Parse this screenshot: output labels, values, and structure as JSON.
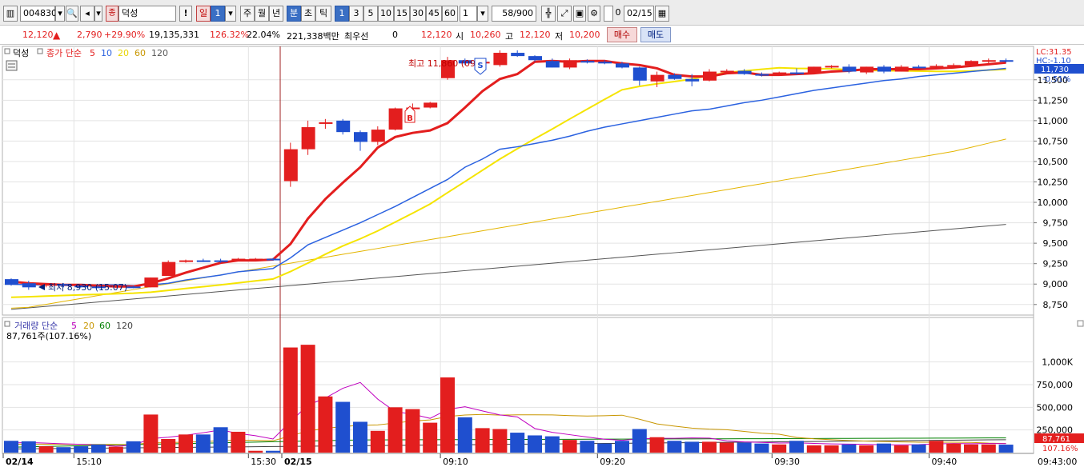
{
  "toolbar": {
    "code": "004830",
    "stock_name": "덕성",
    "name_badge": "종",
    "periods": [
      "일",
      "주",
      "월",
      "년",
      "분",
      "초",
      "틱"
    ],
    "minute_buttons": [
      "1",
      "3",
      "5",
      "10",
      "15",
      "30",
      "45",
      "60"
    ],
    "count_value": "1",
    "page_counter": "58/900",
    "checkbox_value": "0",
    "date": "02/15"
  },
  "quote": {
    "price": "12,120",
    "change": "2,790",
    "change_pct": "+29.90%",
    "volume": "19,135,331",
    "volume_pct": "126.32%",
    "turnover": "22.04%",
    "amount": "221,338백만",
    "priority_label": "최우선",
    "priority_value": "0",
    "price2": "12,120",
    "open_label": "시",
    "open": "10,260",
    "high_label": "고",
    "high": "12,120",
    "low_label": "저",
    "low": "10,200",
    "buy_label": "매수",
    "sell_label": "매도"
  },
  "colors": {
    "up": "#e31e1e",
    "down": "#1f4fcf",
    "ma5": "#e31e1e",
    "ma10": "#2b62e0",
    "ma20": "#f5e400",
    "ma60": "#e4b500",
    "ma120": "#555555",
    "vol_ma5": "#c000c0",
    "vol_ma20": "#c89600",
    "vol_ma60": "#008000",
    "vol_ma120": "#404040"
  },
  "price_panel": {
    "name_tag": "덕성",
    "legend_prefix": "종가 단순",
    "ma_periods": [
      "5",
      "10",
      "20",
      "60",
      "120"
    ],
    "high_annotation": "최고 11,860 (09",
    "low_annotation": "최저 8,930 (15:07)",
    "lc_label": "LC:31.35",
    "hc_label": "HC:-1.10",
    "current_price": "11,730",
    "current_change": "-0.51%",
    "y_ticks": [
      "11,500",
      "11,250",
      "11,000",
      "10,750",
      "10,500",
      "10,250",
      "10,000",
      "9,750",
      "9,500",
      "9,250",
      "9,000",
      "8,750"
    ],
    "markers": [
      "B",
      "S"
    ]
  },
  "volume_panel": {
    "legend_prefix": "거래량 단순",
    "ma_periods": [
      "5",
      "20",
      "60",
      "120"
    ],
    "current_text": "87,761주(107.16%)",
    "current_label": "87,761",
    "current_pct": "107.16%",
    "y_ticks": [
      "1,000K",
      "750,000",
      "500,000",
      "250,000"
    ]
  },
  "time_axis": {
    "labels": [
      "02/14",
      "15:10",
      "15:30",
      "02/15",
      "09:10",
      "09:20",
      "09:30",
      "09:40"
    ],
    "right_label": "09:43:00"
  },
  "chart_data": {
    "type": "candlestick",
    "candles": [
      {
        "o": 9060,
        "h": 9070,
        "l": 8980,
        "c": 8990
      },
      {
        "o": 9010,
        "h": 9040,
        "l": 8930,
        "c": 8960
      },
      {
        "o": 8990,
        "h": 9000,
        "l": 8960,
        "c": 9000
      },
      {
        "o": 9000,
        "h": 9010,
        "l": 8960,
        "c": 8980
      },
      {
        "o": 8980,
        "h": 8990,
        "l": 8960,
        "c": 8970
      },
      {
        "o": 8970,
        "h": 8990,
        "l": 8950,
        "c": 8960
      },
      {
        "o": 8960,
        "h": 8990,
        "l": 8950,
        "c": 8980
      },
      {
        "o": 8970,
        "h": 8980,
        "l": 8950,
        "c": 8960
      },
      {
        "o": 8960,
        "h": 9080,
        "l": 8960,
        "c": 9080
      },
      {
        "o": 9100,
        "h": 9290,
        "l": 9100,
        "c": 9270
      },
      {
        "o": 9280,
        "h": 9300,
        "l": 9260,
        "c": 9290
      },
      {
        "o": 9290,
        "h": 9310,
        "l": 9270,
        "c": 9280
      },
      {
        "o": 9290,
        "h": 9310,
        "l": 9260,
        "c": 9280
      },
      {
        "o": 9300,
        "h": 9320,
        "l": 9280,
        "c": 9310
      },
      {
        "o": 9300,
        "h": 9320,
        "l": 9280,
        "c": 9310
      },
      {
        "o": 9310,
        "h": 9320,
        "l": 9290,
        "c": 9300
      },
      {
        "o": 10260,
        "h": 10730,
        "l": 10190,
        "c": 10650
      },
      {
        "o": 10650,
        "h": 11000,
        "l": 10580,
        "c": 10920
      },
      {
        "o": 10960,
        "h": 11020,
        "l": 10900,
        "c": 10980
      },
      {
        "o": 11000,
        "h": 11020,
        "l": 10830,
        "c": 10860
      },
      {
        "o": 10860,
        "h": 10880,
        "l": 10630,
        "c": 10740
      },
      {
        "o": 10740,
        "h": 10930,
        "l": 10700,
        "c": 10890
      },
      {
        "o": 10890,
        "h": 11160,
        "l": 10880,
        "c": 11150
      },
      {
        "o": 11150,
        "h": 11210,
        "l": 11080,
        "c": 11160
      },
      {
        "o": 11160,
        "h": 11230,
        "l": 11150,
        "c": 11220
      },
      {
        "o": 11520,
        "h": 11780,
        "l": 11500,
        "c": 11740
      },
      {
        "o": 11740,
        "h": 11760,
        "l": 11680,
        "c": 11700
      },
      {
        "o": 11700,
        "h": 11760,
        "l": 11680,
        "c": 11720
      },
      {
        "o": 11680,
        "h": 11860,
        "l": 11660,
        "c": 11830
      },
      {
        "o": 11830,
        "h": 11860,
        "l": 11780,
        "c": 11790
      },
      {
        "o": 11790,
        "h": 11800,
        "l": 11720,
        "c": 11740
      },
      {
        "o": 11730,
        "h": 11760,
        "l": 11650,
        "c": 11650
      },
      {
        "o": 11650,
        "h": 11760,
        "l": 11630,
        "c": 11740
      },
      {
        "o": 11730,
        "h": 11750,
        "l": 11700,
        "c": 11720
      },
      {
        "o": 11720,
        "h": 11740,
        "l": 11690,
        "c": 11700
      },
      {
        "o": 11700,
        "h": 11720,
        "l": 11640,
        "c": 11650
      },
      {
        "o": 11650,
        "h": 11660,
        "l": 11430,
        "c": 11490
      },
      {
        "o": 11480,
        "h": 11600,
        "l": 11410,
        "c": 11560
      },
      {
        "o": 11560,
        "h": 11580,
        "l": 11500,
        "c": 11510
      },
      {
        "o": 11510,
        "h": 11570,
        "l": 11420,
        "c": 11480
      },
      {
        "o": 11490,
        "h": 11630,
        "l": 11480,
        "c": 11600
      },
      {
        "o": 11600,
        "h": 11630,
        "l": 11580,
        "c": 11610
      },
      {
        "o": 11610,
        "h": 11630,
        "l": 11560,
        "c": 11570
      },
      {
        "o": 11570,
        "h": 11590,
        "l": 11540,
        "c": 11560
      },
      {
        "o": 11560,
        "h": 11600,
        "l": 11550,
        "c": 11590
      },
      {
        "o": 11590,
        "h": 11640,
        "l": 11560,
        "c": 11580
      },
      {
        "o": 11580,
        "h": 11660,
        "l": 11570,
        "c": 11660
      },
      {
        "o": 11660,
        "h": 11680,
        "l": 11640,
        "c": 11670
      },
      {
        "o": 11660,
        "h": 11690,
        "l": 11580,
        "c": 11600
      },
      {
        "o": 11590,
        "h": 11660,
        "l": 11570,
        "c": 11660
      },
      {
        "o": 11660,
        "h": 11680,
        "l": 11580,
        "c": 11600
      },
      {
        "o": 11600,
        "h": 11680,
        "l": 11600,
        "c": 11660
      },
      {
        "o": 11660,
        "h": 11680,
        "l": 11640,
        "c": 11650
      },
      {
        "o": 11650,
        "h": 11690,
        "l": 11640,
        "c": 11670
      },
      {
        "o": 11670,
        "h": 11700,
        "l": 11650,
        "c": 11680
      },
      {
        "o": 11680,
        "h": 11740,
        "l": 11670,
        "c": 11730
      },
      {
        "o": 11730,
        "h": 11760,
        "l": 11700,
        "c": 11740
      },
      {
        "o": 11740,
        "h": 11760,
        "l": 11710,
        "c": 11730
      }
    ],
    "volume": [
      130000,
      125000,
      70000,
      60000,
      70000,
      90000,
      65000,
      125000,
      420000,
      150000,
      200000,
      200000,
      280000,
      230000,
      20000,
      20000,
      1160000,
      1190000,
      620000,
      560000,
      340000,
      240000,
      500000,
      480000,
      330000,
      830000,
      390000,
      270000,
      260000,
      220000,
      190000,
      180000,
      140000,
      130000,
      100000,
      130000,
      260000,
      170000,
      130000,
      120000,
      120000,
      110000,
      110000,
      100000,
      90000,
      130000,
      80000,
      80000,
      90000,
      80000,
      100000,
      80000,
      90000,
      130000,
      100000,
      90000,
      90000,
      87761
    ],
    "ma5": [
      9030,
      9010,
      9000,
      8990,
      8990,
      8980,
      8970,
      8970,
      9010,
      9070,
      9140,
      9200,
      9260,
      9290,
      9290,
      9300,
      9490,
      9800,
      10040,
      10240,
      10430,
      10670,
      10800,
      10850,
      10880,
      10970,
      11160,
      11360,
      11510,
      11570,
      11720,
      11730,
      11720,
      11730,
      11730,
      11700,
      11680,
      11640,
      11560,
      11540,
      11540,
      11580,
      11590,
      11560,
      11560,
      11570,
      11580,
      11600,
      11610,
      11630,
      11630,
      11630,
      11630,
      11640,
      11650,
      11670,
      11690,
      11710
    ],
    "ma10": [
      9000,
      8990,
      8990,
      8990,
      8990,
      8990,
      8990,
      8980,
      8990,
      9010,
      9050,
      9080,
      9110,
      9150,
      9170,
      9190,
      9320,
      9480,
      9570,
      9660,
      9750,
      9850,
      9950,
      10060,
      10170,
      10280,
      10430,
      10530,
      10650,
      10680,
      10720,
      10760,
      10810,
      10870,
      10920,
      10960,
      11000,
      11040,
      11080,
      11120,
      11140,
      11180,
      11220,
      11250,
      11290,
      11330,
      11370,
      11400,
      11430,
      11460,
      11490,
      11510,
      11540,
      11560,
      11580,
      11600,
      11620,
      11640
    ],
    "x_labels": [
      "02/14",
      "15:10",
      "15:30",
      "02/15",
      "09:10",
      "09:20",
      "09:30",
      "09:40"
    ],
    "ylim": [
      8650,
      11850
    ]
  }
}
